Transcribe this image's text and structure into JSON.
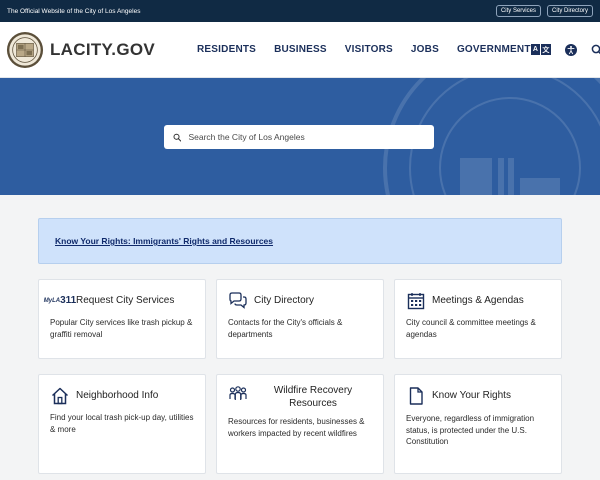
{
  "topbar": {
    "official_text": "The Official Website of the City of Los Angeles",
    "links": [
      "City Services",
      "City Directory"
    ]
  },
  "header": {
    "brand": "LACITY.GOV",
    "nav": [
      "RESIDENTS",
      "BUSINESS",
      "VISITORS",
      "JOBS",
      "GOVERNMENT"
    ],
    "translate_glyphs": [
      "A",
      "文"
    ]
  },
  "search": {
    "placeholder": "Search the City of Los Angeles"
  },
  "alert": {
    "link_text": "Know Your Rights: Immigrants' Rights and Resources"
  },
  "cards": [
    {
      "icon": "myla311-icon",
      "icon_text_top": "MyLA",
      "icon_text_bottom": "311",
      "title": "Request City Services",
      "desc": "Popular City services like trash pickup & graffiti removal"
    },
    {
      "icon": "chat-bubbles-icon",
      "title": "City Directory",
      "desc": "Contacts for the City's officials & departments"
    },
    {
      "icon": "calendar-icon",
      "title": "Meetings & Agendas",
      "desc": "City council & committee meetings & agendas"
    },
    {
      "icon": "house-icon",
      "title": "Neighborhood Info",
      "desc": "Find your local trash pick-up day, utilities & more"
    },
    {
      "icon": "people-icon",
      "title": "Wildfire Recovery Resources",
      "desc": "Resources for residents, businesses & workers impacted by recent wildfires"
    },
    {
      "icon": "document-icon",
      "title": "Know Your Rights",
      "desc": "Everyone, regardless of immigration status, is protected under the U.S. Constitution"
    }
  ],
  "colors": {
    "topbar": "#102a44",
    "nav_text": "#1b2f5a",
    "hero": "#2e5da0",
    "alert_bg": "#cfe2fb"
  }
}
